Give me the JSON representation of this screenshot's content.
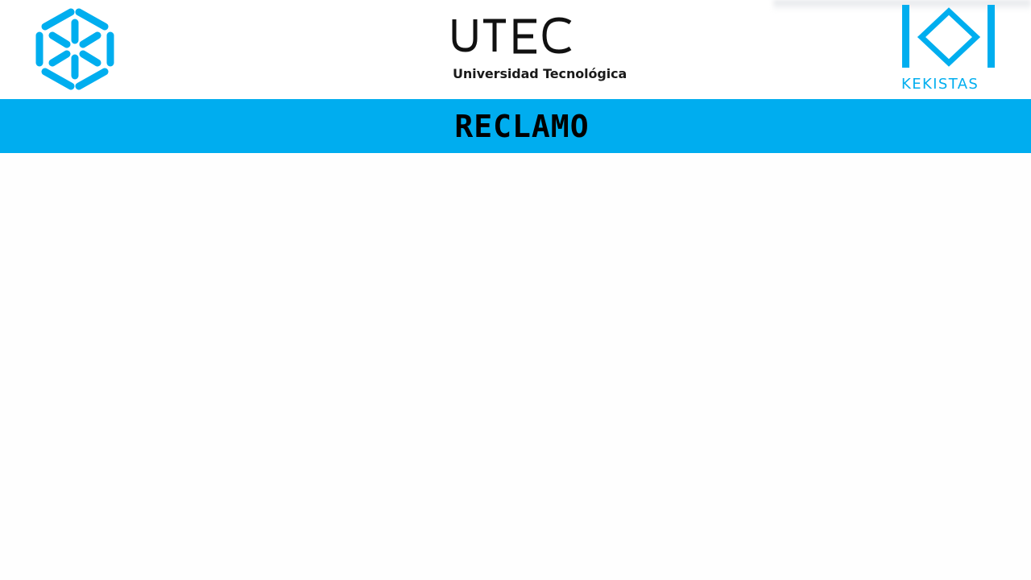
{
  "header": {
    "left_logo": {
      "icon": "hexagon-logo-icon",
      "color": "#00aeef"
    },
    "center_logo": {
      "title": "UTEC",
      "subtitle": "Universidad Tecnológica"
    },
    "right_logo": {
      "icon": "kekistas-logo-icon",
      "label": "KEKISTAS",
      "color": "#00aeef"
    }
  },
  "title_bar": {
    "text": "RECLAMO",
    "background": "#00adef"
  }
}
